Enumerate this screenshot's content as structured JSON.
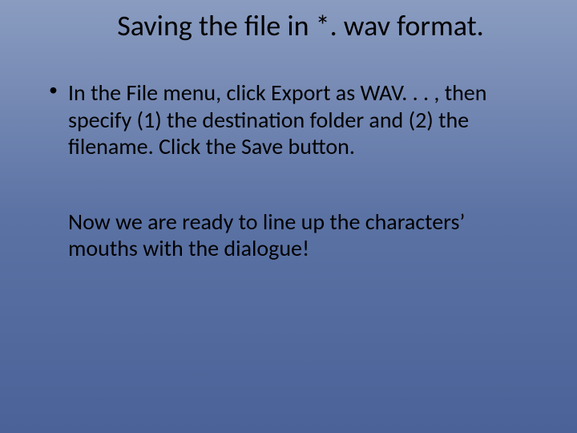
{
  "title": "Saving the file in *. wav format.",
  "bullet1": "In the File menu, click Export as WAV. . . , then specify (1) the destination folder and (2) the filename. Click the Save button.",
  "followup": "Now we are ready to line up the characters’ mouths with the dialogue!"
}
